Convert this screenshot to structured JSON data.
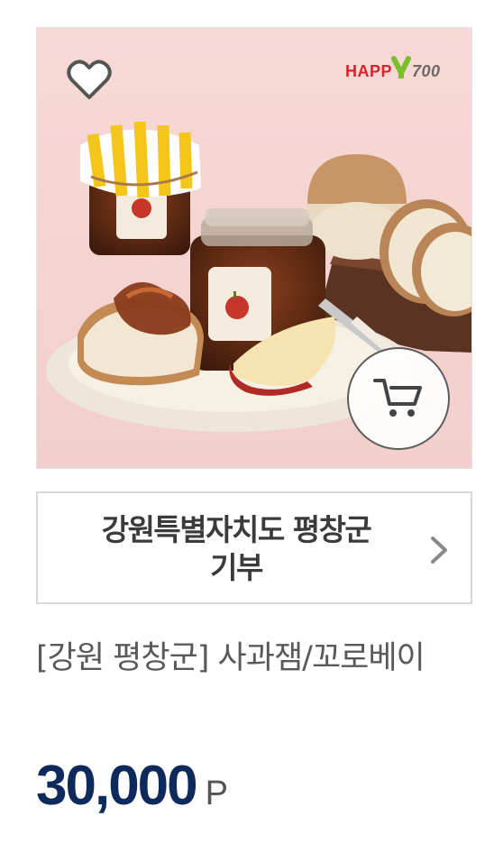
{
  "product": {
    "brand_logo_text": "HAPPY700",
    "donation_label": "강원특별자치도 평창군\n기부",
    "title": "[강원 평창군] 사과잼/꼬로베이",
    "price": "30,000",
    "price_unit": "P"
  },
  "icons": {
    "wishlist": "heart-outline-icon",
    "cart": "shopping-cart-icon",
    "donation_arrow": "chevron-right-icon"
  },
  "colors": {
    "price": "#0e2a5c",
    "background_photo": "#f6d6d3",
    "border": "#d9d9d9",
    "title": "#595959"
  }
}
